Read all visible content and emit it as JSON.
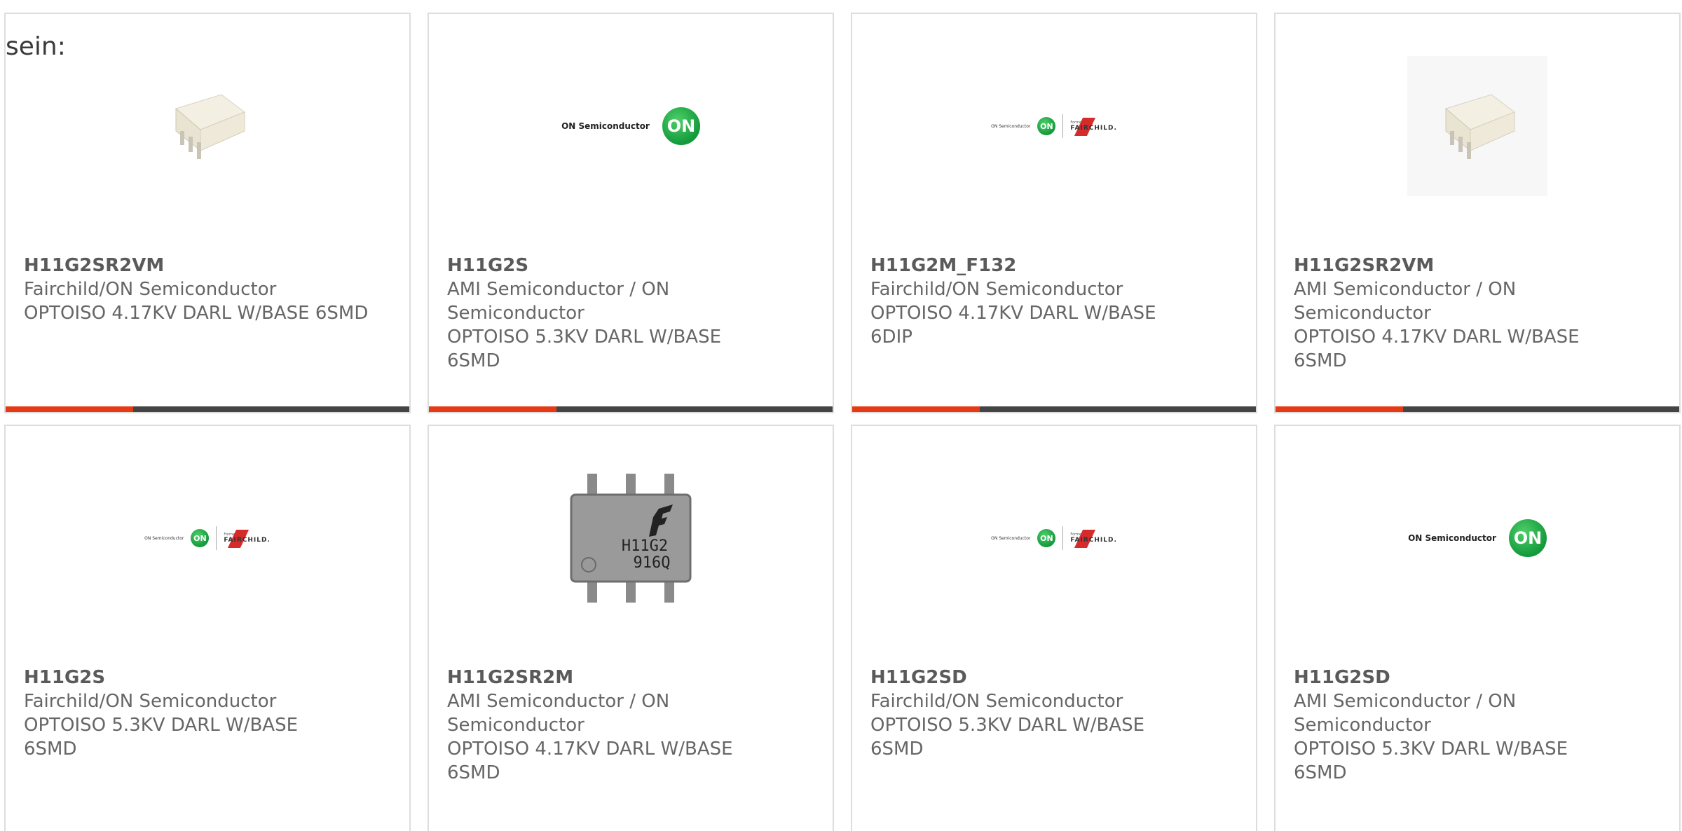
{
  "intro_text": "sein:",
  "colors": {
    "accent": "#e53a14",
    "bar": "#444444",
    "border": "#dddddd"
  },
  "cards": [
    {
      "part": "H11G2SR2VM",
      "maker": "Fairchild/ON Semiconductor",
      "desc": "OPTOISO 4.17KV DARL W/BASE 6SMD",
      "image": "white-smd-chip"
    },
    {
      "part": "H11G2S",
      "maker": "AMI Semiconductor / ON Semiconductor",
      "desc": "OPTOISO 5.3KV DARL W/BASE 6SMD",
      "image": "on-semiconductor-logo"
    },
    {
      "part": "H11G2M_F132",
      "maker": "Fairchild/ON Semiconductor",
      "desc": "OPTOISO 4.17KV DARL W/BASE 6DIP",
      "image": "on-fairchild-logo"
    },
    {
      "part": "H11G2SR2VM",
      "maker": "AMI Semiconductor / ON Semiconductor",
      "desc": "OPTOISO 4.17KV DARL W/BASE 6SMD",
      "image": "white-smd-chip"
    },
    {
      "part": "H11G2S",
      "maker": "Fairchild/ON Semiconductor",
      "desc": "OPTOISO 5.3KV DARL W/BASE 6SMD",
      "image": "on-fairchild-logo"
    },
    {
      "part": "H11G2SR2M",
      "maker": "AMI Semiconductor / ON Semiconductor",
      "desc": "OPTOISO 4.17KV DARL W/BASE 6SMD",
      "image": "gray-dip-chip",
      "chip_marking": [
        "H11G2",
        "916Q"
      ]
    },
    {
      "part": "H11G2SD",
      "maker": "Fairchild/ON Semiconductor",
      "desc": "OPTOISO 5.3KV DARL W/BASE 6SMD",
      "image": "on-fairchild-logo"
    },
    {
      "part": "H11G2SD",
      "maker": "AMI Semiconductor / ON Semiconductor",
      "desc": "OPTOISO 5.3KV DARL W/BASE 6SMD",
      "image": "on-semiconductor-logo"
    }
  ],
  "logos": {
    "on_brand": "ON Semiconductor",
    "on_mark": "ON",
    "fairchild_prefix": "Formerly",
    "fairchild_name": "FAIRCHILD."
  }
}
